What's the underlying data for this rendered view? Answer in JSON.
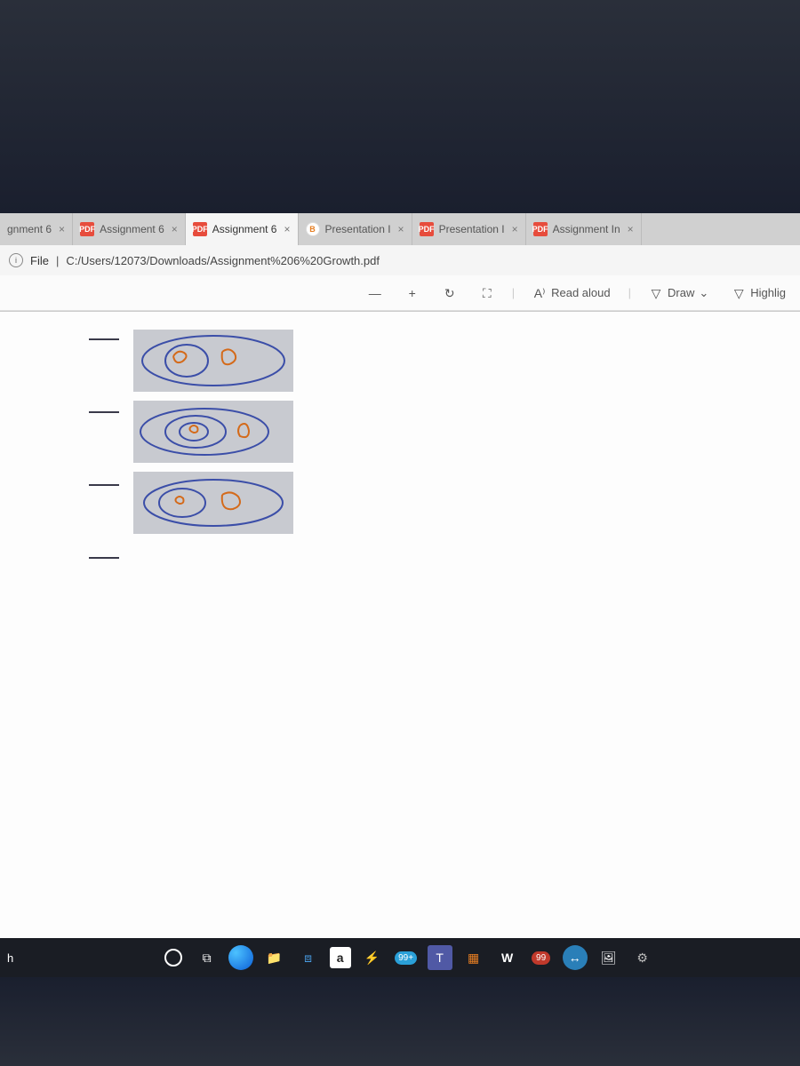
{
  "tabs": [
    {
      "label": "gnment 6",
      "iconType": "none"
    },
    {
      "label": "Assignment 6",
      "iconType": "pdf"
    },
    {
      "label": "Assignment 6",
      "iconType": "pdf",
      "active": true
    },
    {
      "label": "Presentation I",
      "iconType": "b"
    },
    {
      "label": "Presentation I",
      "iconType": "pdf"
    },
    {
      "label": "Assignment In",
      "iconType": "pdf"
    }
  ],
  "address": {
    "info_icon": "i",
    "prefix": "File",
    "separator": "|",
    "path": "C:/Users/12073/Downloads/Assignment%206%20Growth.pdf"
  },
  "toolbar": {
    "zoom_out": "—",
    "zoom_in": "+",
    "rotate": "↻",
    "fit": "⛶",
    "read_aloud_icon": "A⁾",
    "read_aloud_label": "Read aloud",
    "draw_icon": "▽",
    "draw_label": "Draw",
    "draw_chevron": "⌄",
    "highlight_icon": "▽",
    "highlight_label": "Highlig"
  },
  "content": {
    "sketches": [
      {
        "name": "diagram-row-1"
      },
      {
        "name": "diagram-row-2"
      },
      {
        "name": "diagram-row-3"
      }
    ]
  },
  "taskbar": {
    "search_fragment": "h",
    "badge_teams": "99+",
    "badge_notify": "99",
    "icons": {
      "cortana": "O",
      "taskview": "⧉",
      "edge": "e",
      "explorer": "📁",
      "dropbox": "⧈",
      "amazon": "a",
      "winamp": "⚡",
      "teams": "T",
      "grid": "▦",
      "word": "W",
      "reload": "↔",
      "photos": "🖼",
      "settings": "⚙"
    }
  }
}
